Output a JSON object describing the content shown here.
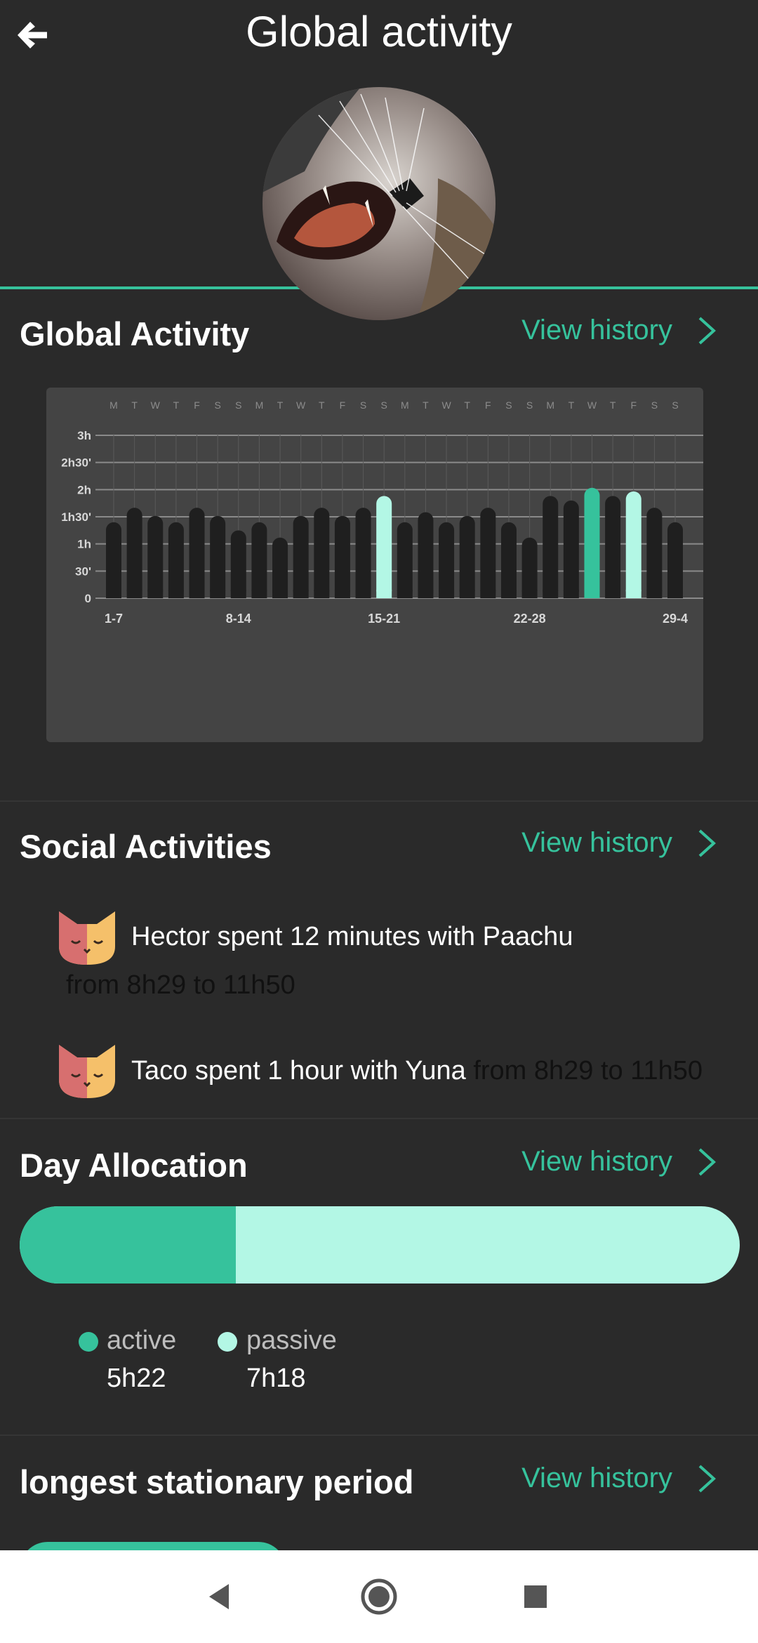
{
  "header": {
    "title": "Global activity",
    "back_icon": "arrow-left-icon"
  },
  "colors": {
    "accent": "#36c29c",
    "accent_light": "#b3f7e5",
    "background": "#2a2a2a",
    "panel": "#444444",
    "bar_dark": "#1f1f1f"
  },
  "global_activity": {
    "title": "Global Activity",
    "view_history": "View history"
  },
  "chart_data": {
    "type": "bar",
    "day_letters": [
      "M",
      "T",
      "W",
      "T",
      "F",
      "S",
      "S",
      "M",
      "T",
      "W",
      "T",
      "F",
      "S",
      "S",
      "M",
      "T",
      "W",
      "T",
      "F",
      "S",
      "S",
      "M",
      "T",
      "W",
      "T",
      "F",
      "S",
      "S"
    ],
    "y_ticks": [
      "3h",
      "2h30'",
      "2h",
      "1h30'",
      "1h",
      "30'",
      "0"
    ],
    "y_tick_values": [
      180,
      150,
      120,
      90,
      60,
      30,
      0
    ],
    "ylim": [
      0,
      180
    ],
    "week_labels": [
      "1-7",
      "8-14",
      "15-21",
      "22-28",
      "29-4"
    ],
    "week_label_index": [
      0,
      6,
      13,
      20,
      27
    ],
    "values": [
      84,
      100,
      91,
      84,
      100,
      91,
      75,
      84,
      67,
      91,
      100,
      91,
      100,
      113,
      84,
      95,
      84,
      91,
      100,
      84,
      67,
      113,
      108,
      122,
      113,
      118,
      100,
      84
    ],
    "highlight": {
      "13": "light",
      "23": "accent",
      "25": "light"
    },
    "grid": true
  },
  "social": {
    "title": "Social Activities",
    "view_history": "View history",
    "items": [
      {
        "text": "Hector spent 12 minutes with Paachu",
        "time": "from 8h29 to 11h50",
        "icon": "cat-face-icon"
      },
      {
        "text": "Taco spent 1 hour with Yuna",
        "time": "from 8h29 to 11h50",
        "icon": "cat-face-icon"
      }
    ]
  },
  "day_allocation": {
    "title": "Day Allocation",
    "view_history": "View history",
    "active_fraction": 0.3,
    "active": {
      "label": "active",
      "value": "5h22"
    },
    "passive": {
      "label": "passive",
      "value": "7h18"
    }
  },
  "stationary": {
    "title": "longest stationary period",
    "view_history": "View history"
  },
  "navbar": {
    "back": "nav-back-icon",
    "home": "nav-home-icon",
    "recents": "nav-recents-icon"
  }
}
